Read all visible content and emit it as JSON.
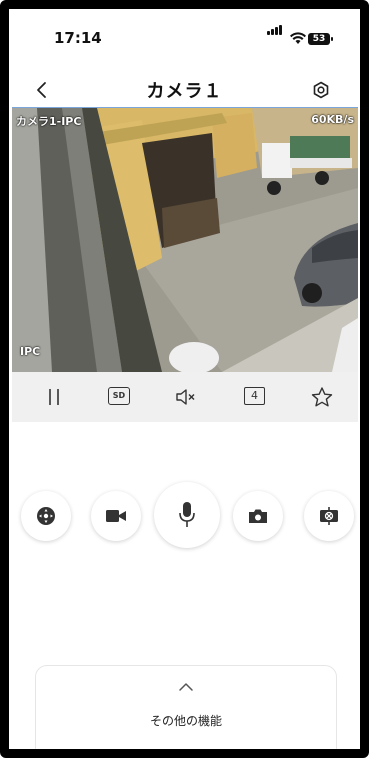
{
  "status_bar": {
    "time": "17:14",
    "battery_level": "53"
  },
  "header": {
    "title": "カメラ１"
  },
  "video": {
    "camera_label": "カメラ1-IPC",
    "bitrate": "60KB/s",
    "ipc_badge": "IPC"
  },
  "toolbar": {
    "quality_label": "SD",
    "split_count": "4"
  },
  "controls": {
    "ptz": "ptz-icon",
    "record": "video-camera-icon",
    "talk": "microphone-icon",
    "snapshot": "camera-icon",
    "lens": "lens-control-icon"
  },
  "more": {
    "label": "その他の機能"
  },
  "colors": {
    "accent_border": "#7aa6d9",
    "toolbar_bg": "#f0f0f0",
    "icon": "#333333"
  }
}
